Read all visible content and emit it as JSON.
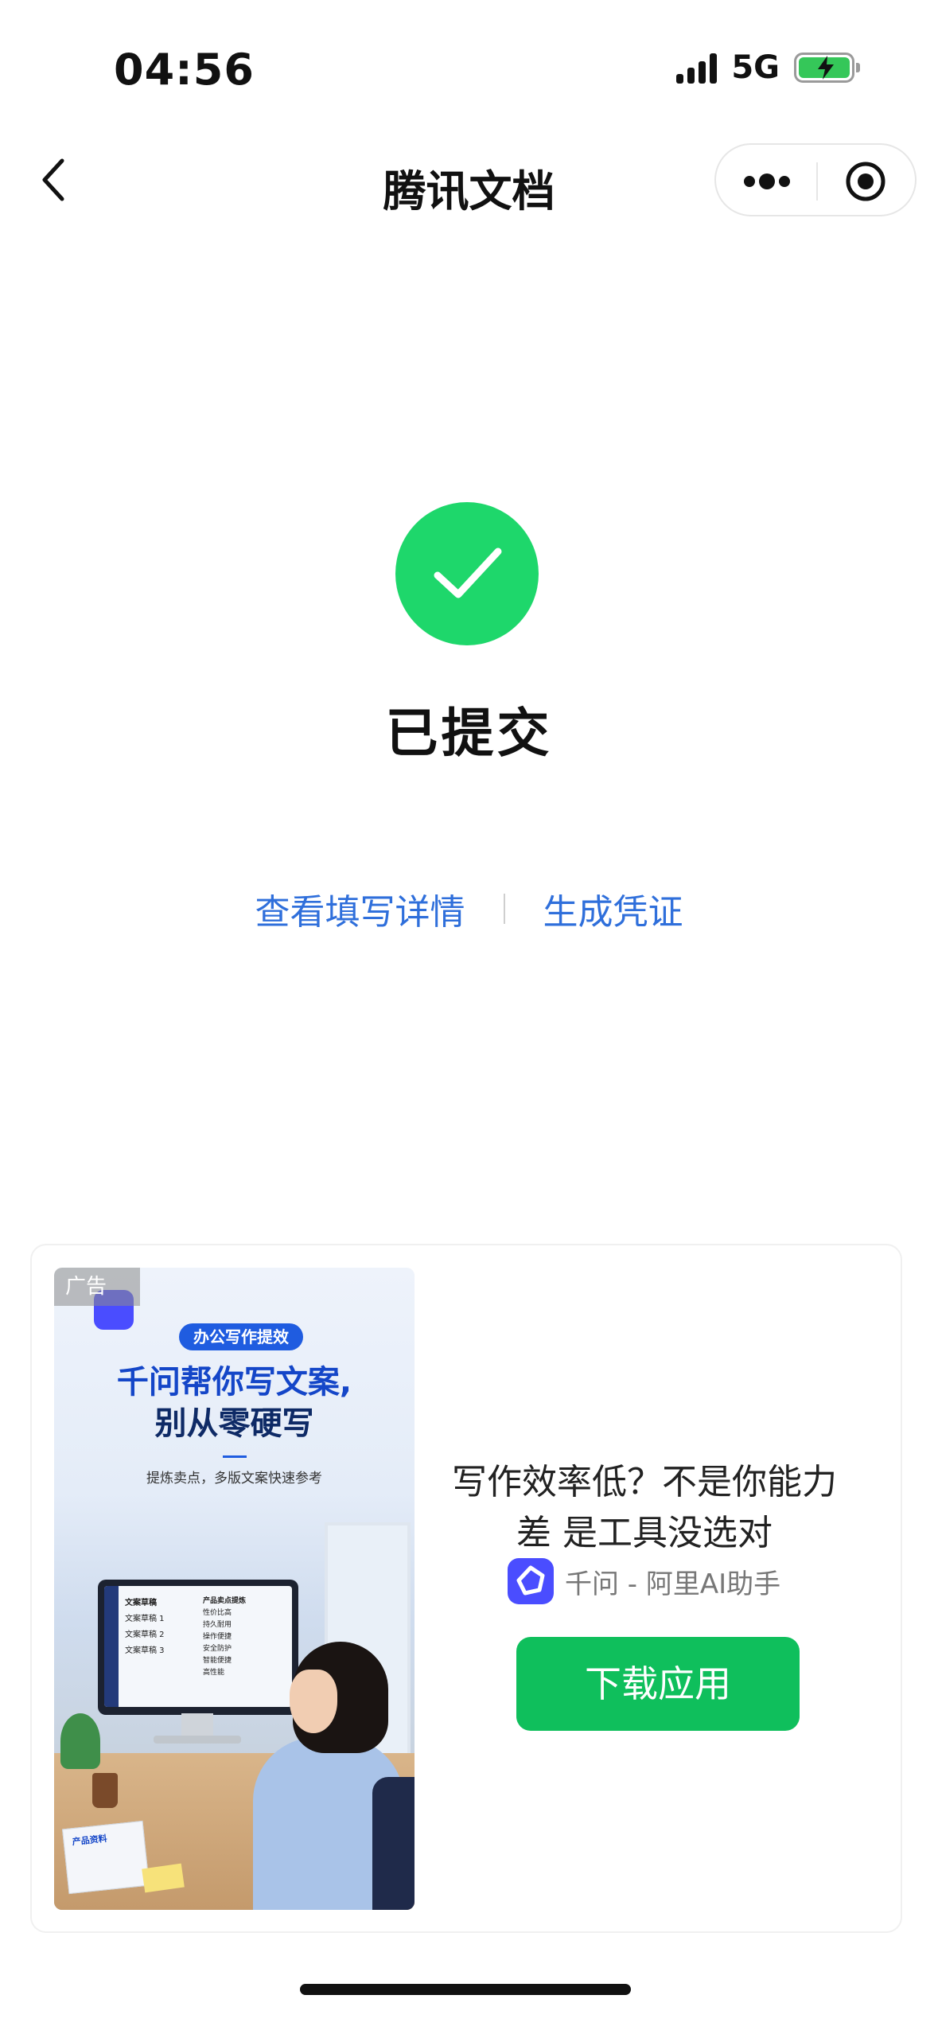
{
  "status_bar": {
    "time": "04:56",
    "network": "5G"
  },
  "nav": {
    "title": "腾讯文档"
  },
  "result": {
    "title": "已提交",
    "status_color": "#1ed76b"
  },
  "actions": {
    "view_details": "查看填写详情",
    "generate_proof": "生成凭证",
    "link_color": "#2f6fdb"
  },
  "ad": {
    "tag": "广告",
    "image": {
      "pill": "办公写作提效",
      "headline_1": "千问帮你写文案,",
      "headline_2": "别从零硬写",
      "subline": "提炼卖点，多版文案快速参考",
      "screen_col1": [
        "文案草稿",
        "文案草稿 1",
        "文案草稿 2",
        "文案草稿 3"
      ],
      "screen_col2": [
        "产品卖点提炼",
        "性价比高",
        "持久耐用",
        "操作便捷",
        "安全防护",
        "智能便捷",
        "高性能"
      ],
      "papers_label": "产品资料"
    },
    "copy": "写作效率低？不是你能力差 是工具没选对",
    "brand": "千问 - 阿里AI助手",
    "button": "下载应用",
    "button_color": "#0fbf5c"
  }
}
